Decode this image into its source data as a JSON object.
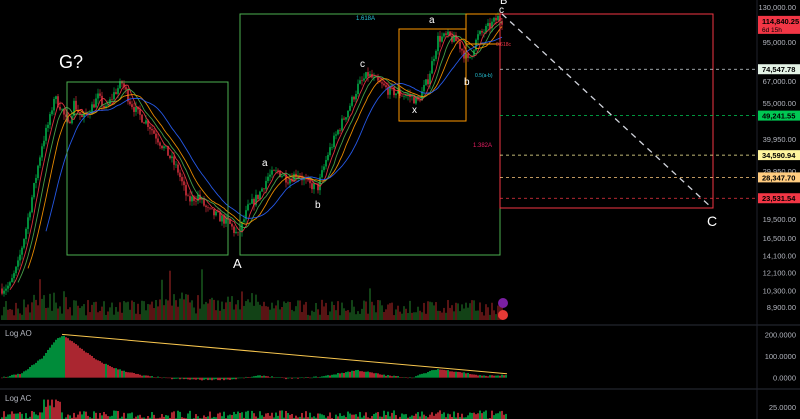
{
  "chart_data": {
    "type": "candlestick",
    "title": "",
    "y_axis": {
      "scale": "log",
      "ticks": [
        "130,000.00",
        "95,000.00",
        "67,000.00",
        "55,000.00",
        "39,950.00",
        "29,950.00",
        "19,500.00",
        "16,500.00",
        "14,100.00",
        "12,100.00",
        "10,300.00",
        "8,900.00"
      ],
      "tick_values": [
        130000,
        95000,
        67000,
        55000,
        39950,
        29950,
        19500,
        16500,
        14100,
        12100,
        10300,
        8900
      ],
      "range": [
        8500,
        150000
      ]
    },
    "price_scale_tags": [
      {
        "label": "114,840.25",
        "sublabel": "6d 15h",
        "value": 114840.25,
        "bg": "#f23645",
        "fg": "#000000",
        "kind": "last-price"
      },
      {
        "label": "74,547.78",
        "value": 74547.78,
        "bg": "#e3f2e5",
        "fg": "#000000",
        "kind": "level"
      },
      {
        "label": "49,241.55",
        "value": 49241.55,
        "bg": "#00c853",
        "fg": "#000000",
        "kind": "level"
      },
      {
        "label": "34,590.94",
        "value": 34590.94,
        "bg": "#fff59d",
        "fg": "#000000",
        "kind": "level"
      },
      {
        "label": "28,347.70",
        "value": 28347.7,
        "bg": "#ffcc80",
        "fg": "#000000",
        "kind": "level"
      },
      {
        "label": "23,531.54",
        "value": 23531.54,
        "bg": "#f23645",
        "fg": "#000000",
        "kind": "level"
      }
    ],
    "horizontal_levels": [
      {
        "value": 74547.78,
        "color": "#cfd8dc",
        "style": "dashed"
      },
      {
        "value": 49241.55,
        "color": "#00c853",
        "style": "dashed"
      },
      {
        "value": 34590.94,
        "color": "#fff59d",
        "style": "dashed"
      },
      {
        "value": 28347.7,
        "color": "#ffcc80",
        "style": "dashed"
      },
      {
        "value": 23531.54,
        "color": "#f23645",
        "style": "dashed"
      }
    ],
    "wave_labels": [
      "G?",
      "A",
      "a",
      "b",
      "c",
      "a",
      "x",
      "b",
      "c",
      "B",
      "C"
    ],
    "fib_labels": [
      {
        "text": "1.618A",
        "color": "#26c6da"
      },
      {
        "text": "1.382A",
        "color": "#e91e63"
      },
      {
        "text": "0.618c",
        "color": "#f23645"
      },
      {
        "text": "0.5(a-b)",
        "color": "#26c6da"
      }
    ],
    "price_series": {
      "x_range": [
        0,
        500
      ],
      "ma_colors": [
        "#f23645",
        "#4caf50",
        "#ff9800",
        "#2962ff"
      ],
      "up_color": "#00c853",
      "down_color": "#f23645",
      "anchors": [
        {
          "x": 0,
          "price": 10500
        },
        {
          "x": 8,
          "price": 10800
        },
        {
          "x": 16,
          "price": 13000
        },
        {
          "x": 24,
          "price": 18000
        },
        {
          "x": 32,
          "price": 26000
        },
        {
          "x": 40,
          "price": 38000
        },
        {
          "x": 48,
          "price": 48000
        },
        {
          "x": 52,
          "price": 58000
        },
        {
          "x": 58,
          "price": 54000
        },
        {
          "x": 66,
          "price": 45000
        },
        {
          "x": 72,
          "price": 55000
        },
        {
          "x": 80,
          "price": 48000
        },
        {
          "x": 88,
          "price": 52000
        },
        {
          "x": 96,
          "price": 58000
        },
        {
          "x": 104,
          "price": 52000
        },
        {
          "x": 112,
          "price": 60000
        },
        {
          "x": 120,
          "price": 66000
        },
        {
          "x": 128,
          "price": 56000
        },
        {
          "x": 136,
          "price": 50000
        },
        {
          "x": 146,
          "price": 46000
        },
        {
          "x": 156,
          "price": 40000
        },
        {
          "x": 166,
          "price": 35000
        },
        {
          "x": 176,
          "price": 30000
        },
        {
          "x": 186,
          "price": 23000
        },
        {
          "x": 196,
          "price": 24000
        },
        {
          "x": 206,
          "price": 21000
        },
        {
          "x": 216,
          "price": 20000
        },
        {
          "x": 226,
          "price": 19000
        },
        {
          "x": 236,
          "price": 16800
        },
        {
          "x": 246,
          "price": 21500
        },
        {
          "x": 256,
          "price": 24000
        },
        {
          "x": 266,
          "price": 28500
        },
        {
          "x": 276,
          "price": 29800
        },
        {
          "x": 286,
          "price": 28000
        },
        {
          "x": 296,
          "price": 29500
        },
        {
          "x": 306,
          "price": 26500
        },
        {
          "x": 316,
          "price": 26000
        },
        {
          "x": 326,
          "price": 35000
        },
        {
          "x": 336,
          "price": 43000
        },
        {
          "x": 346,
          "price": 52000
        },
        {
          "x": 356,
          "price": 64000
        },
        {
          "x": 366,
          "price": 71000
        },
        {
          "x": 376,
          "price": 66000
        },
        {
          "x": 386,
          "price": 62000
        },
        {
          "x": 396,
          "price": 60000
        },
        {
          "x": 406,
          "price": 59000
        },
        {
          "x": 416,
          "price": 56000
        },
        {
          "x": 426,
          "price": 68000
        },
        {
          "x": 436,
          "price": 98000
        },
        {
          "x": 446,
          "price": 100000
        },
        {
          "x": 456,
          "price": 95000
        },
        {
          "x": 466,
          "price": 80000
        },
        {
          "x": 476,
          "price": 100000
        },
        {
          "x": 486,
          "price": 108000
        },
        {
          "x": 496,
          "price": 118000
        },
        {
          "x": 502,
          "price": 114840
        }
      ]
    },
    "volume": {
      "color_up": "#1b5e20",
      "color_down": "#7f1d1d",
      "max_value": 100
    },
    "log_ao": {
      "title": "Log AO",
      "ticks": [
        "200.0000",
        "100.0000",
        "0.0000"
      ],
      "tick_values": [
        200,
        100,
        0
      ],
      "range": [
        -20,
        220
      ],
      "trendline_color": "#f9c74f",
      "trendline": [
        {
          "x": 60,
          "value": 200
        },
        {
          "x": 505,
          "value": 18
        }
      ],
      "anchors": [
        {
          "x": 0,
          "value": 0
        },
        {
          "x": 20,
          "value": 20
        },
        {
          "x": 40,
          "value": 90
        },
        {
          "x": 55,
          "value": 180
        },
        {
          "x": 62,
          "value": 195
        },
        {
          "x": 75,
          "value": 150
        },
        {
          "x": 95,
          "value": 80
        },
        {
          "x": 115,
          "value": 40
        },
        {
          "x": 140,
          "value": 10
        },
        {
          "x": 170,
          "value": -5
        },
        {
          "x": 200,
          "value": -10
        },
        {
          "x": 230,
          "value": -8
        },
        {
          "x": 260,
          "value": 10
        },
        {
          "x": 285,
          "value": -5
        },
        {
          "x": 320,
          "value": 5
        },
        {
          "x": 355,
          "value": 35
        },
        {
          "x": 385,
          "value": 10
        },
        {
          "x": 410,
          "value": 0
        },
        {
          "x": 435,
          "value": 40
        },
        {
          "x": 460,
          "value": 25
        },
        {
          "x": 480,
          "value": 8
        },
        {
          "x": 505,
          "value": 12
        }
      ]
    },
    "log_ac": {
      "title": "Log AC",
      "ticks": [
        "25.0000"
      ],
      "tick_values": [
        25
      ],
      "range": [
        0,
        40
      ]
    }
  }
}
